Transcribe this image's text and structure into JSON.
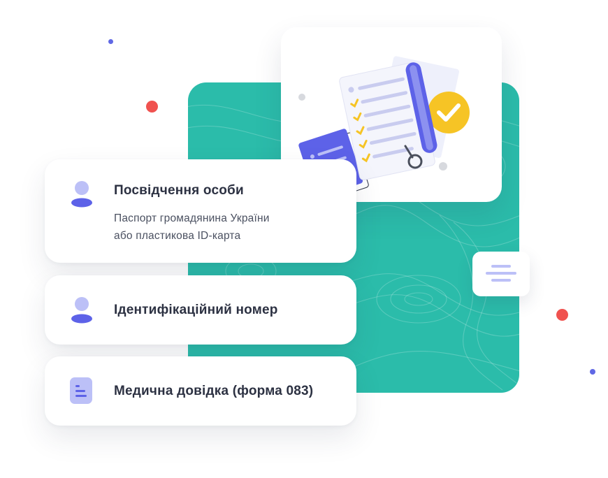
{
  "cards": [
    {
      "title": "Посвідчення особи",
      "description_line1": "Паспорт громадянина України",
      "description_line2": "або пластикова ID-карта",
      "icon": "person-icon"
    },
    {
      "title": "Ідентифікаційний номер",
      "icon": "person-icon"
    },
    {
      "title": "Медична довідка (форма 083)",
      "icon": "document-icon"
    }
  ],
  "illustration": "document-checklist-illustration",
  "mini_card_icon": "text-lines-icon",
  "colors": {
    "teal": "#2bbcaa",
    "card_text": "#2c3142",
    "icon_purple": "#bcc0f7",
    "icon_indigo": "#5d62e8",
    "red_dot": "#f0524f",
    "blue_dot": "#6068e5",
    "gray_dot": "#d7d9de"
  }
}
